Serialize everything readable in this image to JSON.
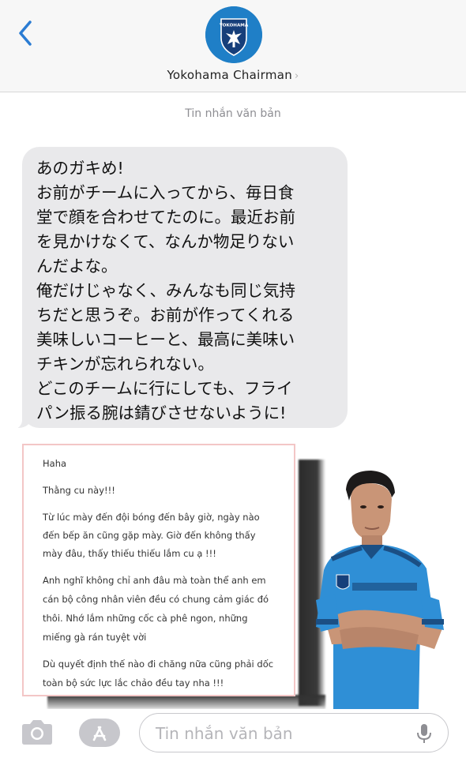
{
  "header": {
    "contact_name": "Yokohama Chairman",
    "chevron": "›",
    "avatar_text": "YOKOHAMA",
    "back_icon": "chevron-left-icon",
    "accent_color": "#2b7cd3"
  },
  "thread": {
    "label": "Tin nhắn văn bản"
  },
  "message": {
    "lines": [
      "あのガキめ!",
      " お前がチームに入ってから、毎日食",
      "堂で顔を合わせてたのに。最近お前",
      "を見かけなくて、なんか物足りない",
      "んだよな。",
      " 俺だけじゃなく、みんなも同じ気持",
      "ちだと思うぞ。お前が作ってくれる",
      "美味しいコーヒーと、最高に美味い",
      "チキンが忘れられない。",
      " どこのチームに行にしても、フライ",
      "パン振る腕は錆びさせないように!"
    ]
  },
  "note": {
    "lines": [
      "Haha",
      "Thằng cu này!!!",
      "Từ lúc mày đến đội bóng đến bây giờ, ngày nào",
      "đến bếp ăn cũng gặp mày. Giờ đến không thấy",
      "mày đâu, thấy thiếu thiếu lắm cu ạ !!!",
      "Anh nghĩ không chỉ anh đâu mà toàn thể anh em",
      "cán bộ công nhân viên đều có chung cảm giác đó",
      "thôi. Nhớ lắm những cốc cà phê ngon, những",
      "miếng gà rán tuyệt vời",
      "Dù quyết định thế nào đi chăng nữa cũng phải dốc",
      "toàn bộ sức lực lắc chảo đều tay nha !!!"
    ]
  },
  "input": {
    "placeholder": "Tin nhắn văn bản",
    "camera_icon": "camera-icon",
    "apps_icon": "app-store-icon",
    "mic_icon": "microphone-icon"
  }
}
